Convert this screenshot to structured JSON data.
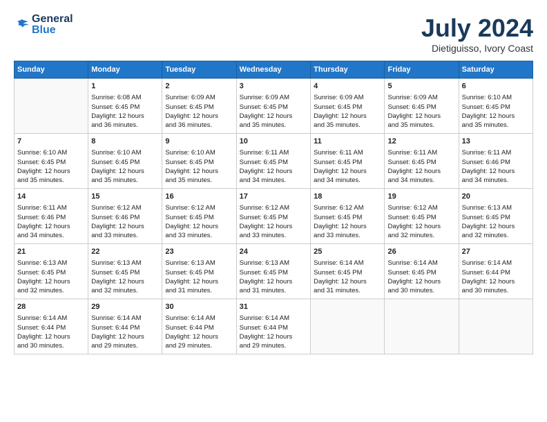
{
  "header": {
    "logo_general": "General",
    "logo_blue": "Blue",
    "title": "July 2024",
    "location": "Dietiguisso, Ivory Coast"
  },
  "days_of_week": [
    "Sunday",
    "Monday",
    "Tuesday",
    "Wednesday",
    "Thursday",
    "Friday",
    "Saturday"
  ],
  "weeks": [
    [
      {
        "day": "",
        "content": ""
      },
      {
        "day": "1",
        "content": "Sunrise: 6:08 AM\nSunset: 6:45 PM\nDaylight: 12 hours\nand 36 minutes."
      },
      {
        "day": "2",
        "content": "Sunrise: 6:09 AM\nSunset: 6:45 PM\nDaylight: 12 hours\nand 36 minutes."
      },
      {
        "day": "3",
        "content": "Sunrise: 6:09 AM\nSunset: 6:45 PM\nDaylight: 12 hours\nand 35 minutes."
      },
      {
        "day": "4",
        "content": "Sunrise: 6:09 AM\nSunset: 6:45 PM\nDaylight: 12 hours\nand 35 minutes."
      },
      {
        "day": "5",
        "content": "Sunrise: 6:09 AM\nSunset: 6:45 PM\nDaylight: 12 hours\nand 35 minutes."
      },
      {
        "day": "6",
        "content": "Sunrise: 6:10 AM\nSunset: 6:45 PM\nDaylight: 12 hours\nand 35 minutes."
      }
    ],
    [
      {
        "day": "7",
        "content": "Sunrise: 6:10 AM\nSunset: 6:45 PM\nDaylight: 12 hours\nand 35 minutes."
      },
      {
        "day": "8",
        "content": "Sunrise: 6:10 AM\nSunset: 6:45 PM\nDaylight: 12 hours\nand 35 minutes."
      },
      {
        "day": "9",
        "content": "Sunrise: 6:10 AM\nSunset: 6:45 PM\nDaylight: 12 hours\nand 35 minutes."
      },
      {
        "day": "10",
        "content": "Sunrise: 6:11 AM\nSunset: 6:45 PM\nDaylight: 12 hours\nand 34 minutes."
      },
      {
        "day": "11",
        "content": "Sunrise: 6:11 AM\nSunset: 6:45 PM\nDaylight: 12 hours\nand 34 minutes."
      },
      {
        "day": "12",
        "content": "Sunrise: 6:11 AM\nSunset: 6:45 PM\nDaylight: 12 hours\nand 34 minutes."
      },
      {
        "day": "13",
        "content": "Sunrise: 6:11 AM\nSunset: 6:46 PM\nDaylight: 12 hours\nand 34 minutes."
      }
    ],
    [
      {
        "day": "14",
        "content": "Sunrise: 6:11 AM\nSunset: 6:46 PM\nDaylight: 12 hours\nand 34 minutes."
      },
      {
        "day": "15",
        "content": "Sunrise: 6:12 AM\nSunset: 6:46 PM\nDaylight: 12 hours\nand 33 minutes."
      },
      {
        "day": "16",
        "content": "Sunrise: 6:12 AM\nSunset: 6:45 PM\nDaylight: 12 hours\nand 33 minutes."
      },
      {
        "day": "17",
        "content": "Sunrise: 6:12 AM\nSunset: 6:45 PM\nDaylight: 12 hours\nand 33 minutes."
      },
      {
        "day": "18",
        "content": "Sunrise: 6:12 AM\nSunset: 6:45 PM\nDaylight: 12 hours\nand 33 minutes."
      },
      {
        "day": "19",
        "content": "Sunrise: 6:12 AM\nSunset: 6:45 PM\nDaylight: 12 hours\nand 32 minutes."
      },
      {
        "day": "20",
        "content": "Sunrise: 6:13 AM\nSunset: 6:45 PM\nDaylight: 12 hours\nand 32 minutes."
      }
    ],
    [
      {
        "day": "21",
        "content": "Sunrise: 6:13 AM\nSunset: 6:45 PM\nDaylight: 12 hours\nand 32 minutes."
      },
      {
        "day": "22",
        "content": "Sunrise: 6:13 AM\nSunset: 6:45 PM\nDaylight: 12 hours\nand 32 minutes."
      },
      {
        "day": "23",
        "content": "Sunrise: 6:13 AM\nSunset: 6:45 PM\nDaylight: 12 hours\nand 31 minutes."
      },
      {
        "day": "24",
        "content": "Sunrise: 6:13 AM\nSunset: 6:45 PM\nDaylight: 12 hours\nand 31 minutes."
      },
      {
        "day": "25",
        "content": "Sunrise: 6:14 AM\nSunset: 6:45 PM\nDaylight: 12 hours\nand 31 minutes."
      },
      {
        "day": "26",
        "content": "Sunrise: 6:14 AM\nSunset: 6:45 PM\nDaylight: 12 hours\nand 30 minutes."
      },
      {
        "day": "27",
        "content": "Sunrise: 6:14 AM\nSunset: 6:44 PM\nDaylight: 12 hours\nand 30 minutes."
      }
    ],
    [
      {
        "day": "28",
        "content": "Sunrise: 6:14 AM\nSunset: 6:44 PM\nDaylight: 12 hours\nand 30 minutes."
      },
      {
        "day": "29",
        "content": "Sunrise: 6:14 AM\nSunset: 6:44 PM\nDaylight: 12 hours\nand 29 minutes."
      },
      {
        "day": "30",
        "content": "Sunrise: 6:14 AM\nSunset: 6:44 PM\nDaylight: 12 hours\nand 29 minutes."
      },
      {
        "day": "31",
        "content": "Sunrise: 6:14 AM\nSunset: 6:44 PM\nDaylight: 12 hours\nand 29 minutes."
      },
      {
        "day": "",
        "content": ""
      },
      {
        "day": "",
        "content": ""
      },
      {
        "day": "",
        "content": ""
      }
    ]
  ]
}
